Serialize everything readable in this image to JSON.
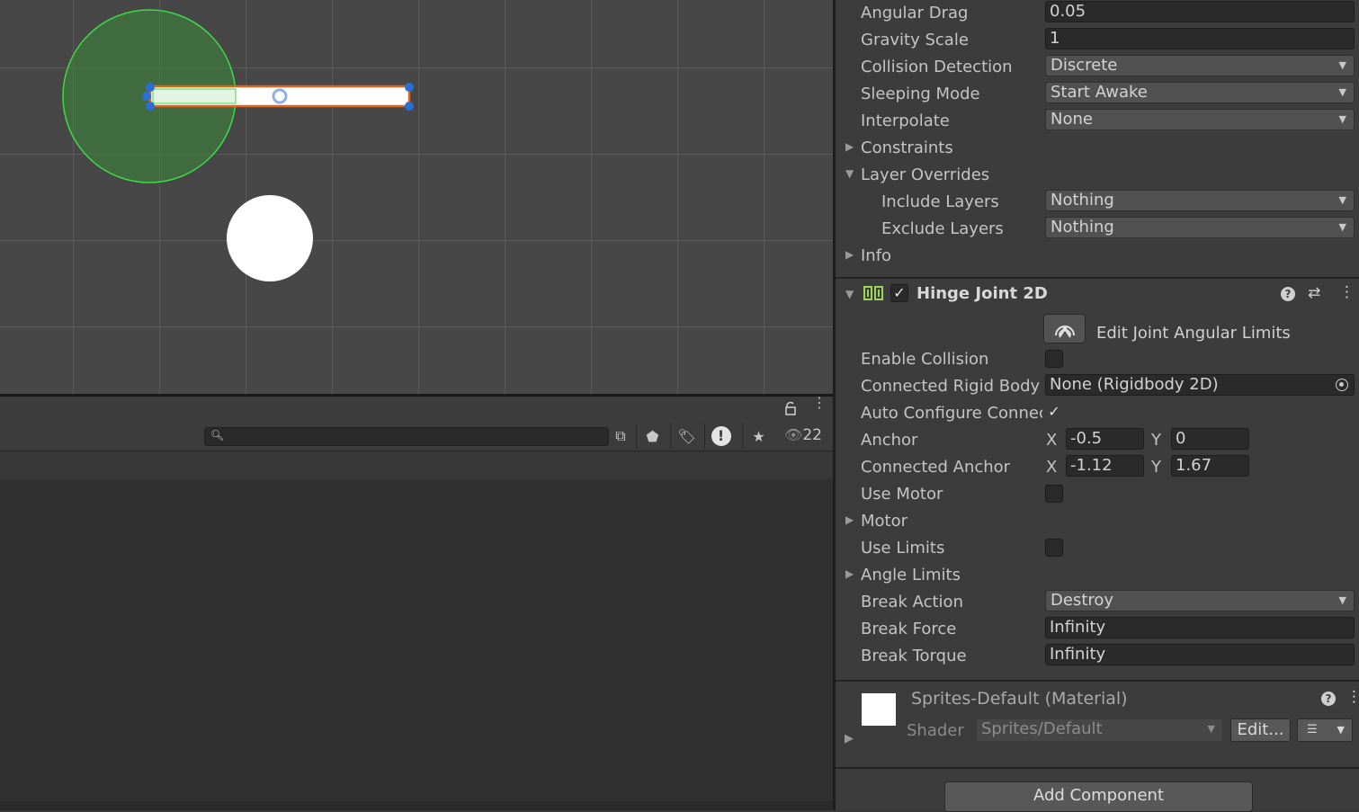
{
  "inspector": {
    "rigidbody_rows": [
      {
        "label": "Angular Drag",
        "kind": "field",
        "value": "0.05"
      },
      {
        "label": "Gravity Scale",
        "kind": "field",
        "value": "1"
      },
      {
        "label": "Collision Detection",
        "kind": "drop",
        "value": "Discrete"
      },
      {
        "label": "Sleeping Mode",
        "kind": "drop",
        "value": "Start Awake"
      },
      {
        "label": "Interpolate",
        "kind": "drop",
        "value": "None"
      }
    ],
    "constraints_label": "Constraints",
    "layer_overrides_label": "Layer Overrides",
    "include_layers_label": "Include Layers",
    "include_layers_value": "Nothing",
    "exclude_layers_label": "Exclude Layers",
    "exclude_layers_value": "Nothing",
    "info_label": "Info",
    "hinge": {
      "title": "Hinge Joint 2D",
      "edit_limits_label": "Edit Joint Angular Limits",
      "enable_collision_label": "Enable Collision",
      "connected_body_label": "Connected Rigid Body",
      "connected_body_value": "None (Rigidbody 2D)",
      "auto_configure_label": "Auto Configure Connec",
      "anchor_label": "Anchor",
      "anchor_x": "-0.5",
      "anchor_y": "0",
      "connected_anchor_label": "Connected Anchor",
      "connected_anchor_x": "-1.12",
      "connected_anchor_y": "1.67",
      "x_label": "X",
      "y_label": "Y",
      "use_motor_label": "Use Motor",
      "motor_label": "Motor",
      "use_limits_label": "Use Limits",
      "angle_limits_label": "Angle Limits",
      "break_action_label": "Break Action",
      "break_action_value": "Destroy",
      "break_force_label": "Break Force",
      "break_force_value": "Infinity",
      "break_torque_label": "Break Torque",
      "break_torque_value": "Infinity"
    },
    "material": {
      "title": "Sprites-Default (Material)",
      "shader_label": "Shader",
      "shader_value": "Sprites/Default",
      "edit_label": "Edit..."
    },
    "add_component_label": "Add Component"
  },
  "hierarchy": {
    "visible_count": "22"
  },
  "colors": {
    "collider_green": "#3fb84a",
    "bar_orange": "#e0651b",
    "handle_blue": "#2b6fd6"
  },
  "icons": {
    "lock": "lock-icon",
    "kebab": "kebab-menu-icon",
    "help": "help-icon",
    "preset": "preset-icon",
    "hinge": "hinge-joint-icon"
  }
}
